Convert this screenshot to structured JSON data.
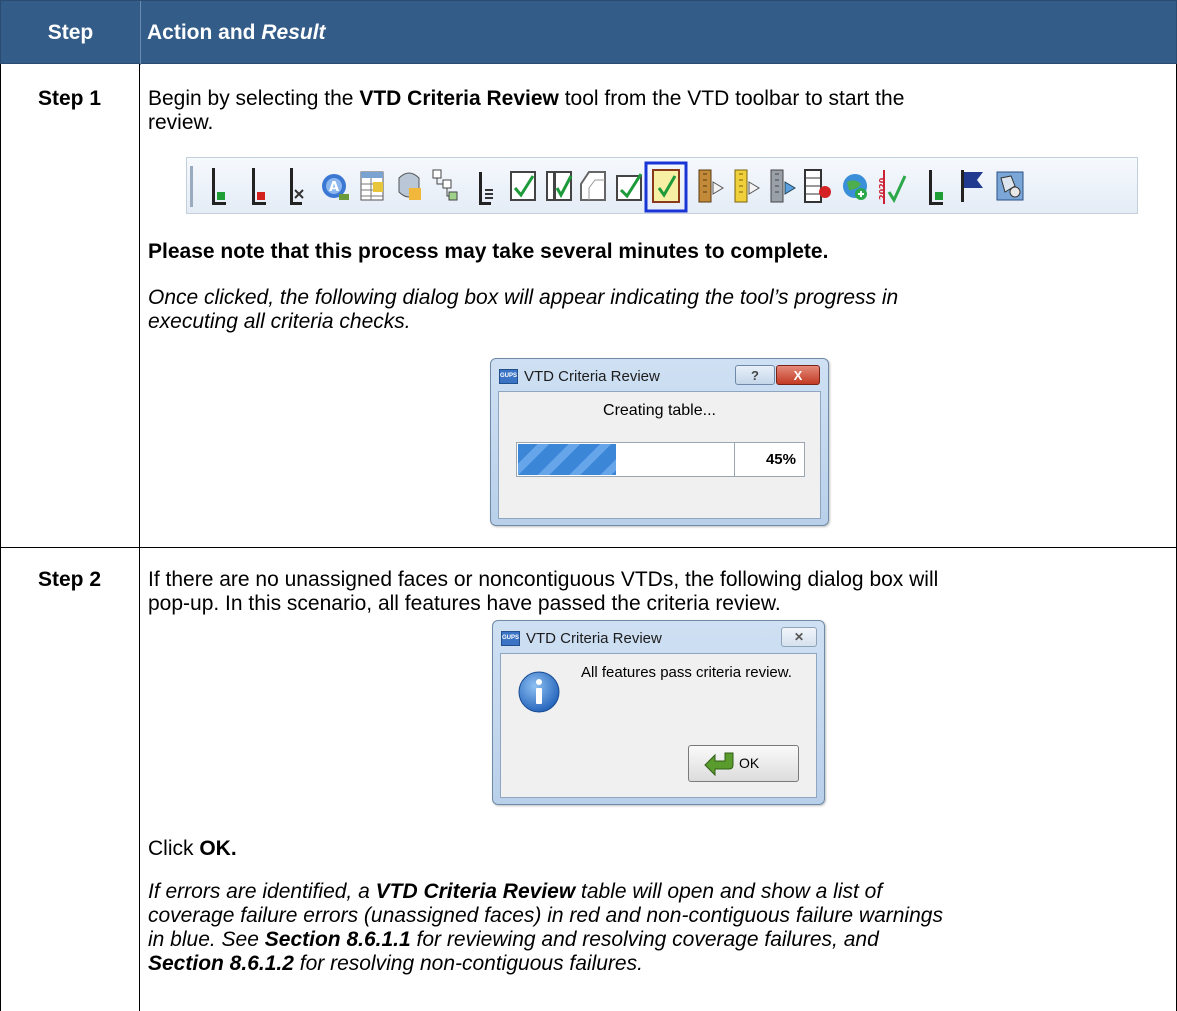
{
  "header": {
    "step_label": "Step",
    "action_label": "Action and ",
    "result_label": "Result"
  },
  "step1": {
    "label": "Step 1",
    "intro_a": "Begin by selecting the ",
    "intro_b": "VTD Criteria Review",
    "intro_c": " tool from the VTD toolbar to start the",
    "intro_d": "review.",
    "note": "Please note that this process may take several minutes to complete.",
    "desc_1": "Once clicked, the following dialog box will appear indicating the tool’s progress in",
    "desc_2": "executing all criteria checks.",
    "toolbar_icons": [
      "add-vtd-icon",
      "delete-vtd-icon",
      "split-vtd-icon",
      "rename-icon",
      "attribute-table-icon",
      "identify-icon",
      "hierarchy-icon",
      "boundary-icon",
      "check-icon",
      "check-alt-icon",
      "shape-icon",
      "check-box-icon",
      "vtd-criteria-review-icon",
      "export-icon",
      "export-alt-icon",
      "import-icon",
      "report-icon",
      "globe-add-icon",
      "year-2020-icon",
      "add-point-icon",
      "flag-icon",
      "map-review-icon"
    ],
    "dialog": {
      "title": "VTD Criteria Review",
      "help": "?",
      "close": "X",
      "app_icon": "GUPS",
      "status": "Creating table...",
      "progress": 0.45,
      "percent": "45%"
    }
  },
  "step2": {
    "label": "Step 2",
    "intro_1": "If there are no unassigned faces or noncontiguous VTDs, the following dialog box will",
    "intro_2": "pop-up. In this scenario, all features have passed the criteria review.",
    "dialog": {
      "title": "VTD Criteria Review",
      "app_icon": "GUPS",
      "close": "✕",
      "message": "All features pass criteria review.",
      "ok": "OK"
    },
    "click_a": "Click ",
    "click_b": "OK.",
    "err_1a": "If errors are identified, a ",
    "err_1b": "VTD Criteria Review",
    "err_1c": " table will open and show a list of",
    "err_2": "coverage failure errors (unassigned faces) in red and non-contiguous failure warnings",
    "err_3a": "in blue. See ",
    "err_3b": "Section 8.6.1.1",
    "err_3c": " for reviewing and resolving coverage failures, and",
    "err_4a": "Section 8.6.1.2",
    "err_4b": " for resolving non-contiguous failures."
  }
}
